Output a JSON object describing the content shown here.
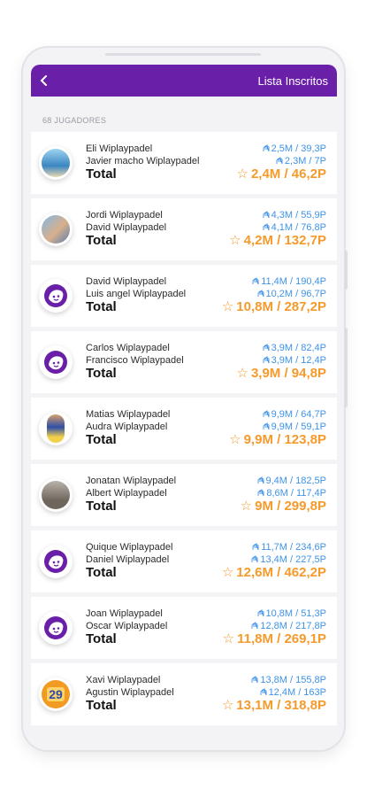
{
  "header": {
    "back_icon": "chevron-left-icon",
    "title": "Lista Inscritos"
  },
  "count_label": "68 JUGADORES",
  "total_label": "Total",
  "colors": {
    "header": "#6a1fa8",
    "stat_blue": "#3f93e6",
    "total_orange": "#f59a2b"
  },
  "rows": [
    {
      "avatar": "photo-beach",
      "p1": "Eli Wiplaypadel",
      "p2": "Javier macho Wiplaypadel",
      "s1": "2,5M / 39,3P",
      "s2": "2,3M / 7P",
      "total": "2,4M / 46,2P"
    },
    {
      "avatar": "photo-couple",
      "p1": "Jordi Wiplaypadel",
      "p2": "David Wiplaypadel",
      "s1": "4,3M / 55,9P",
      "s2": "4,1M / 76,8P",
      "total": "4,2M / 132,7P"
    },
    {
      "avatar": "face-icon",
      "p1": "David Wiplaypadel",
      "p2": "Luis angel Wiplaypadel",
      "s1": "11,4M / 190,4P",
      "s2": "10,2M / 96,7P",
      "total": "10,8M / 287,2P"
    },
    {
      "avatar": "face-icon",
      "p1": "Carlos Wiplaypadel",
      "p2": "Francisco Wiplaypadel",
      "s1": "3,9M / 82,4P",
      "s2": "3,9M / 12,4P",
      "total": "3,9M / 94,8P"
    },
    {
      "avatar": "photo-player",
      "p1": "Matias Wiplaypadel",
      "p2": "Audra Wiplaypadel",
      "s1": "9,9M / 64,7P",
      "s2": "9,9M / 59,1P",
      "total": "9,9M / 123,8P"
    },
    {
      "avatar": "photo-man",
      "p1": "Jonatan Wiplaypadel",
      "p2": "Albert Wiplaypadel",
      "s1": "9,4M / 182,5P",
      "s2": "8,6M / 117,4P",
      "total": "9M / 299,8P"
    },
    {
      "avatar": "face-icon",
      "p1": "Quique Wiplaypadel",
      "p2": "Daniel Wiplaypadel",
      "s1": "11,7M / 234,6P",
      "s2": "13,4M / 227,5P",
      "total": "12,6M / 462,2P"
    },
    {
      "avatar": "face-icon",
      "p1": "Joan Wiplaypadel",
      "p2": "Oscar Wiplaypadel",
      "s1": "10,8M / 51,3P",
      "s2": "12,8M / 217,8P",
      "total": "11,8M / 269,1P"
    },
    {
      "avatar": "number-29",
      "avatar_text": "29",
      "p1": "Xavi Wiplaypadel",
      "p2": "Agustin Wiplaypadel",
      "s1": "13,8M / 155,8P",
      "s2": "12,4M / 163P",
      "total": "13,1M / 318,8P"
    }
  ]
}
